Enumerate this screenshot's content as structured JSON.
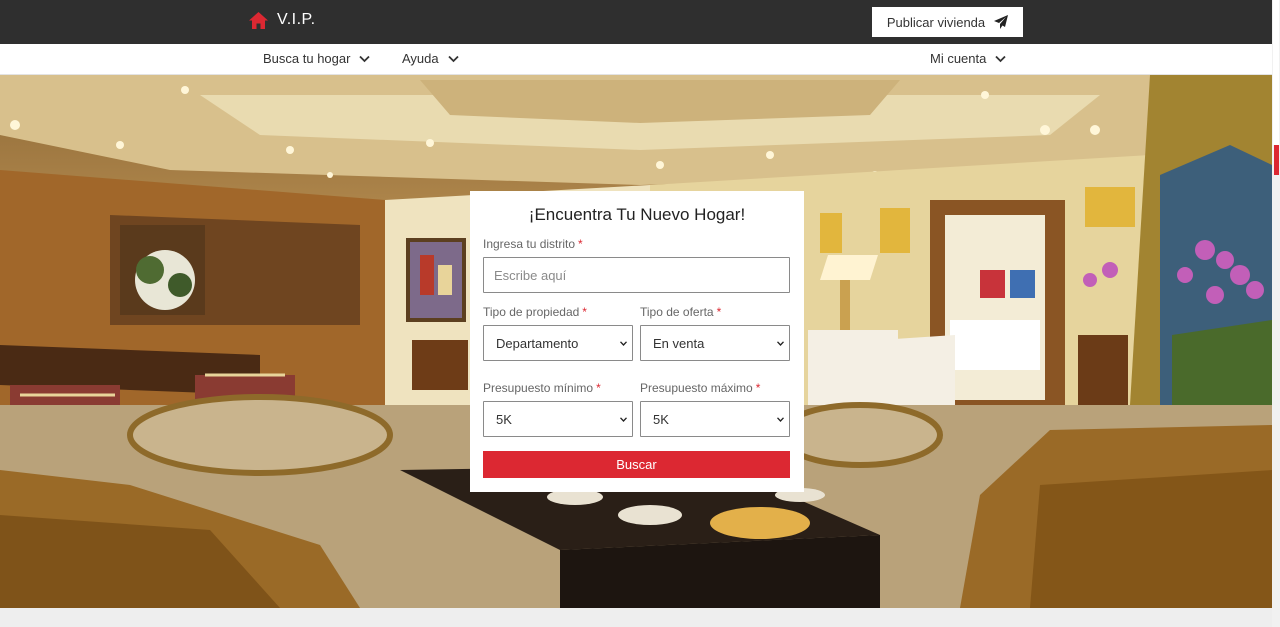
{
  "header": {
    "brand_name": "V.I.P.",
    "publish_label": "Publicar vivienda"
  },
  "nav": {
    "items": [
      {
        "label": "Busca tu hogar"
      },
      {
        "label": "Ayuda"
      },
      {
        "label": "Mi cuenta"
      }
    ]
  },
  "search_card": {
    "title": "¡Encuentra Tu Nuevo Hogar!",
    "district_label": "Ingresa tu distrito",
    "district_placeholder": "Escribe aquí",
    "property_type_label": "Tipo de propiedad",
    "property_type_value": "Departamento",
    "offer_type_label": "Tipo de oferta",
    "offer_type_value": "En venta",
    "min_budget_label": "Presupuesto mínimo",
    "min_budget_value": "5K",
    "max_budget_label": "Presupuesto máximo",
    "max_budget_value": "5K",
    "required_mark": "*",
    "search_label": "Buscar"
  },
  "colors": {
    "accent": "#dc2832",
    "topbar": "#2f2f2f",
    "background": "#eeeeee"
  },
  "icons": {
    "brand": "home-icon",
    "publish": "paper-plane-icon",
    "dropdown": "chevron-down-icon"
  }
}
